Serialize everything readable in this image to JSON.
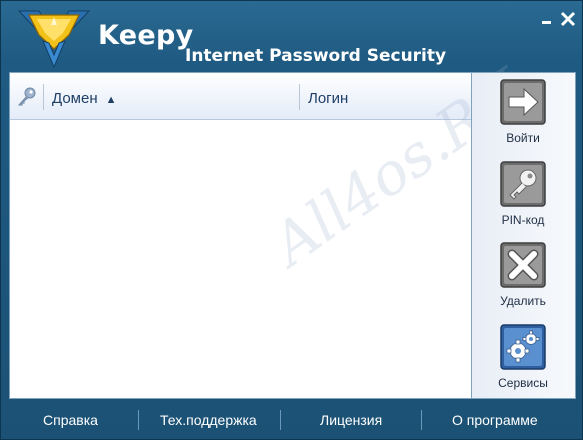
{
  "app": {
    "name": "Keepy",
    "subtitle": "Internet Password Security"
  },
  "list": {
    "columns": [
      "Домен",
      "Логин"
    ],
    "sort_indicator": "▲",
    "rows": []
  },
  "watermark": "All4os.RU",
  "actions": [
    {
      "label": "Войти",
      "icon": "arrow-right-icon"
    },
    {
      "label": "PIN-код",
      "icon": "key-icon"
    },
    {
      "label": "Удалить",
      "icon": "x-delete-icon"
    },
    {
      "label": "Сервисы",
      "icon": "gears-icon"
    }
  ],
  "footer": {
    "links": [
      "Справка",
      "Тех.поддержка",
      "Лицензия",
      "О программе"
    ]
  },
  "colors": {
    "window_blue": "#1f5a82",
    "accent_gray": "#8a8a8a",
    "services_blue": "#4d7fbf"
  }
}
